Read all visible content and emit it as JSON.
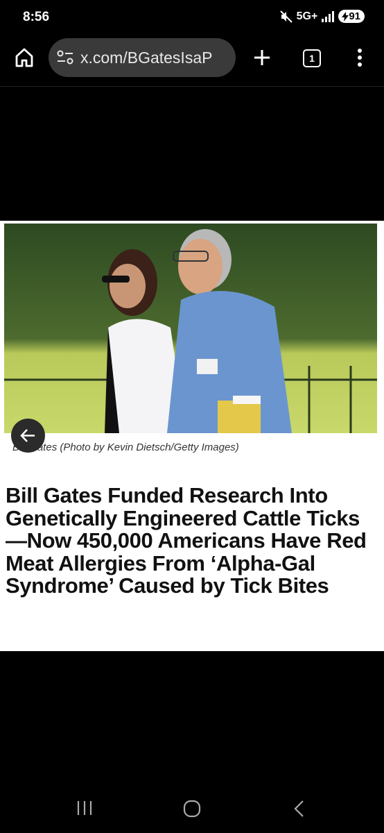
{
  "status_bar": {
    "time": "8:56",
    "network": "5G+",
    "battery": "91"
  },
  "browser": {
    "url": "x.com/BGatesIsaP",
    "tab_count": "1"
  },
  "article": {
    "caption": "Bill Gates (Photo by Kevin Dietsch/Getty Images)",
    "headline": "Bill Gates Funded Research Into Genetically Engineered Cattle Ticks—Now 450,000 Americans Have Red Meat Allergies From ‘Alpha-Gal Syndrome’ Caused by Tick Bites"
  },
  "colors": {
    "background": "#000000",
    "url_bar": "#3a3a3a",
    "card": "#ffffff",
    "headline": "#111111"
  },
  "icons": [
    "home-icon",
    "site-settings-icon",
    "plus-icon",
    "tab-switcher-icon",
    "more-icon",
    "back-arrow-icon",
    "recents-icon",
    "nav-home-icon",
    "nav-back-icon",
    "mute-icon",
    "signal-icon",
    "charging-icon"
  ]
}
